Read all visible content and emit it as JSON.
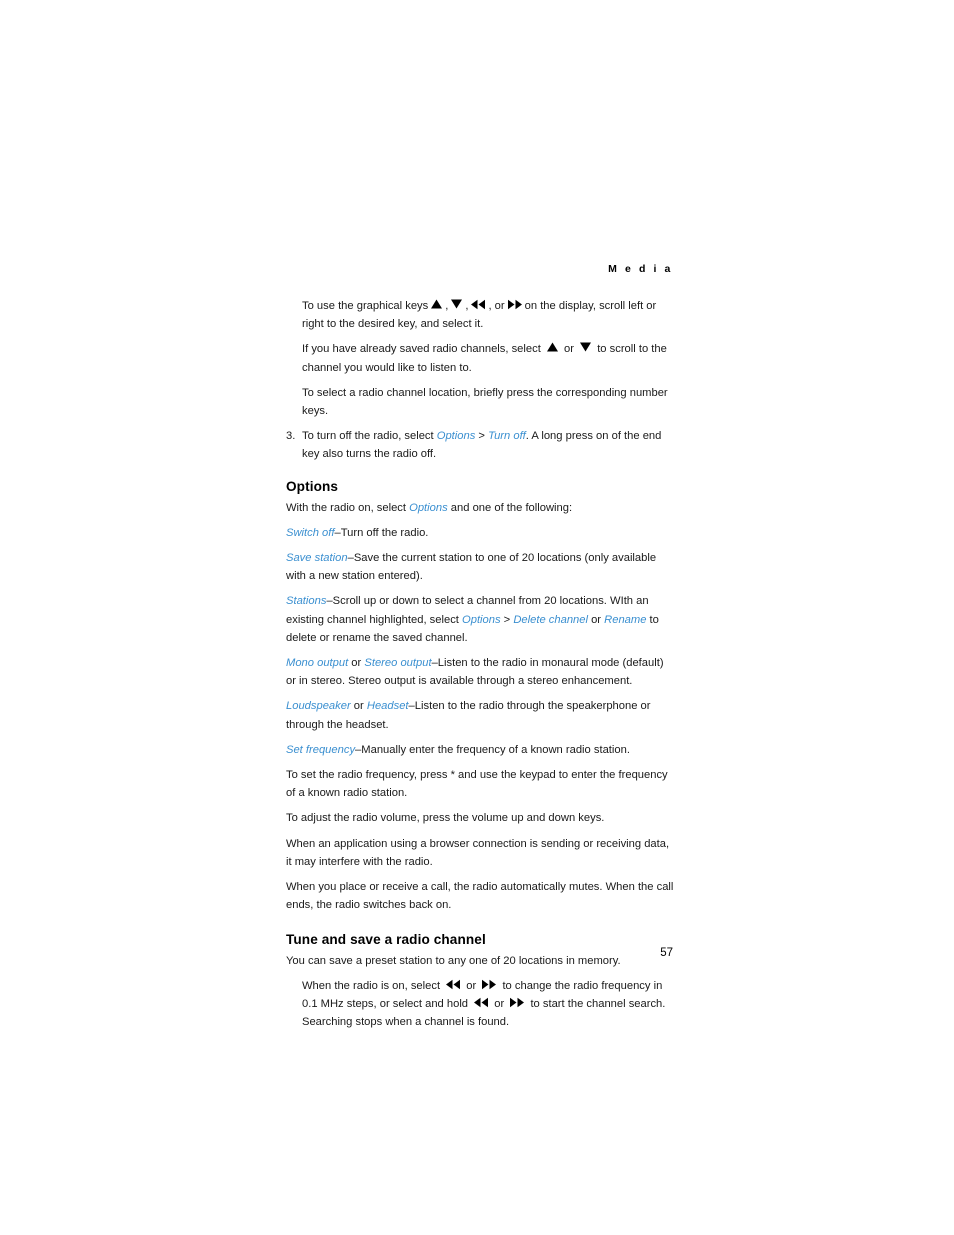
{
  "page": {
    "running_head": "M e d i a",
    "page_number": "57"
  },
  "intro_paragraphs": [
    {
      "id": "graphical-keys",
      "text_before": "To use the graphical keys",
      "icons": [
        "up-triangle-icon",
        "down-triangle-icon",
        "rewind-icon",
        "fast-forward-icon"
      ],
      "text_after": "on the display, scroll left or right to the desired key, and select it."
    },
    {
      "id": "saved-channels",
      "text_before": "If you have already saved radio channels, select",
      "icons": [
        "up-triangle-icon",
        "down-triangle-icon"
      ],
      "text_after": "to scroll to the channel you would like to listen to."
    },
    {
      "id": "channel-location",
      "text": "To select a radio channel location, briefly press the corresponding number keys."
    }
  ],
  "numbered_list": [
    {
      "number": "3.",
      "parts": {
        "a": "To turn off the radio, select ",
        "link1": "Options",
        "sep": " > ",
        "link2": "Turn off",
        "b": ". A long press on of the end key also turns the radio off."
      }
    }
  ],
  "options_section": {
    "heading": "Options",
    "intro": {
      "a": "With the radio on, select ",
      "link1": "Options",
      "b": " and one of the following:"
    },
    "items": [
      {
        "link1": "Switch off",
        "dash": "–",
        "body": "Turn off the radio."
      },
      {
        "link1": "Save station",
        "dash": "–",
        "body": "Save the current station to one of 20 locations (only available with a new station entered)."
      },
      {
        "link1": "Stations",
        "dash": "–",
        "body_a": "Scroll up or down to select a channel from 20 locations. WIth an existing channel highlighted, select ",
        "link2": "Options",
        "sep1": " > ",
        "link3": "Delete channel",
        "sep2": " or ",
        "link4": "Rename",
        "body_b": " to delete or rename the saved channel."
      },
      {
        "link1": "Mono output",
        "joiner": " or ",
        "link2": "Stereo output",
        "dash": "–",
        "body": "Listen to the radio in monaural mode (default) or in stereo. Stereo output is available through a stereo enhancement."
      },
      {
        "link1": "Loudspeaker",
        "joiner": " or ",
        "link2": "Headset",
        "dash": "–",
        "body": "Listen to the radio through the speakerphone or through the headset."
      },
      {
        "link1": "Set frequency",
        "dash": "–",
        "body": "Manually enter the frequency of a known radio station."
      }
    ],
    "trailing_paragraphs": [
      "To set the radio frequency, press * and use the keypad to enter the frequency of a known radio station.",
      "To adjust the radio volume, press the volume up and down keys.",
      "When an application using a browser connection is sending or receiving data, it may interfere with the radio.",
      "When you place or receive a call, the radio automatically mutes. When the call ends, the radio switches back on."
    ]
  },
  "tune_section": {
    "heading": "Tune and save a radio channel",
    "intro": "You can save a preset station to any one of 20 locations in memory.",
    "instruction": {
      "a": "When the radio is on, select",
      "icon1": "rewind-icon",
      "or1": "or",
      "icon2": "fast-forward-icon",
      "b": "to change the radio frequency in 0.1 MHz steps, or select and hold",
      "icon3": "rewind-icon",
      "or2": "or",
      "icon4": "fast-forward-icon",
      "c": "to start the channel search. Searching stops when a channel is found."
    }
  },
  "colors": {
    "link": "#3a8fd0",
    "text": "#1a1a1a",
    "background": "#ffffff"
  }
}
